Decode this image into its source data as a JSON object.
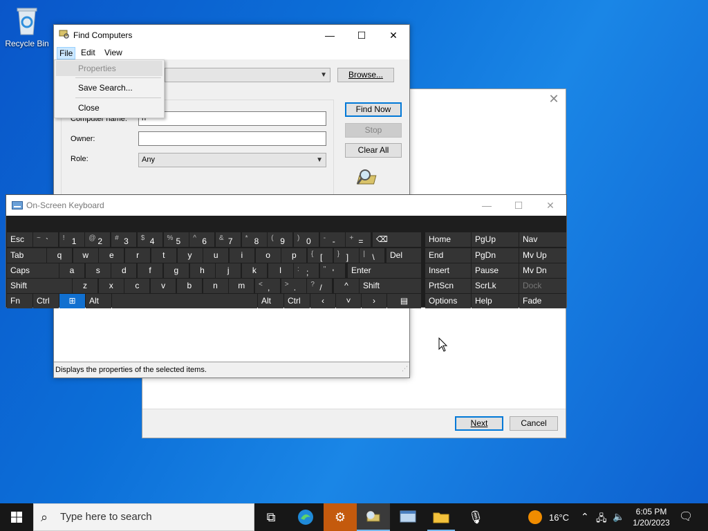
{
  "desktop": {
    "recycle_bin_label": "Recycle Bin"
  },
  "wizard": {
    "next_label": "Next",
    "cancel_label": "Cancel",
    "close_glyph": "✕"
  },
  "find_window": {
    "title": "Find Computers",
    "caption": {
      "minimize": "—",
      "maximize": "☐",
      "close": "✕"
    },
    "menu": [
      "File",
      "Edit",
      "View"
    ],
    "browse_label": "Browse...",
    "find_now_label": "Find Now",
    "stop_label": "Stop",
    "clear_all_label": "Clear All",
    "computer_name_label": "Computer name:",
    "computer_name_value": "n",
    "owner_label": "Owner:",
    "owner_value": "",
    "role_label": "Role:",
    "role_value": "Any",
    "status_text": "Displays the properties of the selected items."
  },
  "file_menu": {
    "items": [
      "Properties",
      "Save Search...",
      "Close"
    ]
  },
  "osk": {
    "title": "On-Screen Keyboard",
    "caption": {
      "minimize": "—",
      "maximize": "☐",
      "close": "✕"
    },
    "row1": {
      "esc": "Esc",
      "keys": [
        {
          "shift": "~",
          "base": "`"
        },
        {
          "shift": "!",
          "base": "1"
        },
        {
          "shift": "@",
          "base": "2"
        },
        {
          "shift": "#",
          "base": "3"
        },
        {
          "shift": "$",
          "base": "4"
        },
        {
          "shift": "%",
          "base": "5"
        },
        {
          "shift": "^",
          "base": "6"
        },
        {
          "shift": "&",
          "base": "7"
        },
        {
          "shift": "*",
          "base": "8"
        },
        {
          "shift": "(",
          "base": "9"
        },
        {
          "shift": ")",
          "base": "0"
        },
        {
          "shift": "-",
          "base": "-"
        },
        {
          "shift": "+",
          "base": "="
        }
      ],
      "backspace": "⌫"
    },
    "row2": {
      "tab": "Tab",
      "keys": [
        "q",
        "w",
        "e",
        "r",
        "t",
        "y",
        "u",
        "i",
        "o",
        "p"
      ],
      "brackets": [
        {
          "shift": "{",
          "base": "["
        },
        {
          "shift": "}",
          "base": "]"
        },
        {
          "shift": "|",
          "base": "\\"
        }
      ],
      "del": "Del"
    },
    "row3": {
      "caps": "Caps",
      "keys": [
        "a",
        "s",
        "d",
        "f",
        "g",
        "h",
        "j",
        "k",
        "l"
      ],
      "punct": [
        {
          "shift": ":",
          "base": ";"
        },
        {
          "shift": "\"",
          "base": "'"
        }
      ],
      "enter": "Enter"
    },
    "row4": {
      "shift": "Shift",
      "keys": [
        "z",
        "x",
        "c",
        "v",
        "b",
        "n",
        "m"
      ],
      "punct": [
        {
          "shift": "<",
          "base": ","
        },
        {
          "shift": ">",
          "base": "."
        },
        {
          "shift": "?",
          "base": "/"
        }
      ],
      "up": "^",
      "shift_right": "Shift"
    },
    "row5": {
      "fn": "Fn",
      "ctrl": "Ctrl",
      "win": "⊞",
      "alt": "Alt",
      "alt_right": "Alt",
      "ctrl_right": "Ctrl",
      "left": "‹",
      "down": "˅",
      "right": "›",
      "menu": "▤"
    },
    "nav": [
      [
        "Home",
        "PgUp",
        "Nav"
      ],
      [
        "End",
        "PgDn",
        "Mv Up"
      ],
      [
        "Insert",
        "Pause",
        "Mv Dn"
      ],
      [
        "PrtScn",
        "ScrLk",
        "Dock"
      ],
      [
        "Options",
        "Help",
        "Fade"
      ]
    ]
  },
  "taskbar": {
    "search_placeholder": "Type here to search",
    "weather": "16°C",
    "time": "6:05 PM",
    "date": "1/20/2023"
  }
}
